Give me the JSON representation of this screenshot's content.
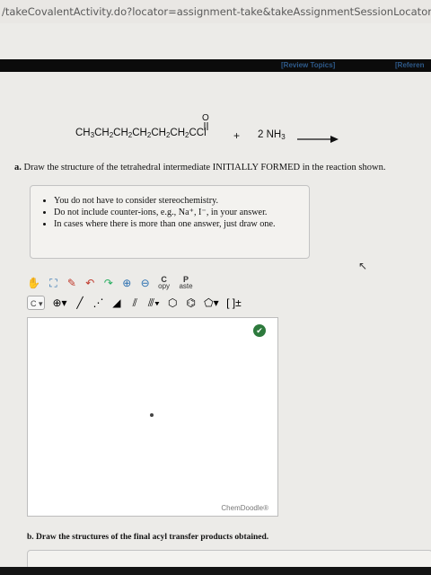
{
  "browser": {
    "url": "/takeCovalentActivity.do?locator=assignment-take&takeAssignmentSessionLocator=assignment-tak"
  },
  "topbar": {
    "review_topics": "[Review Topics]",
    "references": "[Referen"
  },
  "equation": {
    "acyl_prefix": "CH",
    "acyl_chain": [
      "3",
      "CH",
      "2",
      "CH",
      "2",
      "CH",
      "2",
      "CH",
      "2",
      "CH",
      "2"
    ],
    "acyl_tail": "CCl",
    "carbonyl_o": "O",
    "plus": "+",
    "reagent_coeff": "2 NH",
    "reagent_sub": "3"
  },
  "question_a": {
    "label": "a.",
    "text": "Draw the structure of the tetrahedral intermediate INITIALLY FORMED in the reaction shown."
  },
  "notes": [
    "You do not have to consider stereochemistry.",
    "Do not include counter-ions, e.g., Na⁺, I⁻, in your answer.",
    "In cases where there is more than one answer, just draw one."
  ],
  "toolbar": {
    "copy_top": "C",
    "copy_bottom": "opy",
    "paste_top": "P",
    "paste_bottom": "aste",
    "element_select": "C",
    "bracket": "[ ]±"
  },
  "canvas": {
    "watermark": "ChemDoodle®"
  },
  "question_b": {
    "label": "b.",
    "text": "Draw the structures of the final acyl transfer products obtained."
  },
  "colors": {
    "accent": "#2e5a8a",
    "status_green": "#2d7a3d"
  }
}
